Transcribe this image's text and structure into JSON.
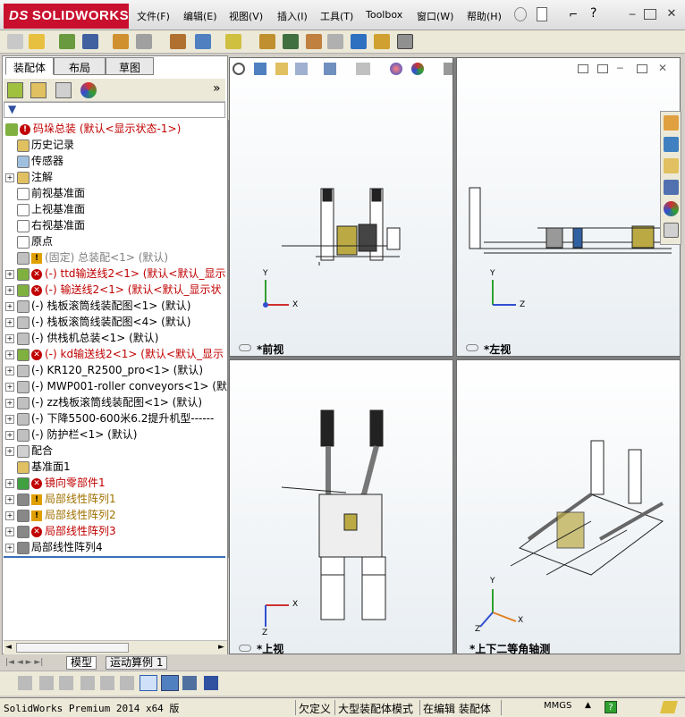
{
  "app": {
    "logo_prefix": "DS",
    "logo_name": "SOLIDWORKS"
  },
  "menu": {
    "items": [
      "文件(F)",
      "编辑(E)",
      "视图(V)",
      "插入(I)",
      "工具(T)",
      "Toolbox",
      "窗口(W)",
      "帮助(H)"
    ]
  },
  "left_tabs": [
    "装配体",
    "布局",
    "草图"
  ],
  "tree": {
    "root": "码垛总装   (默认<显示状态-1>)",
    "items": [
      {
        "label": "历史记录",
        "style": "normal",
        "expand": false,
        "status": ""
      },
      {
        "label": "传感器",
        "style": "normal",
        "expand": false,
        "status": ""
      },
      {
        "label": "注解",
        "style": "normal",
        "expand": true,
        "status": ""
      },
      {
        "label": "前视基准面",
        "style": "normal",
        "expand": false,
        "status": ""
      },
      {
        "label": "上视基准面",
        "style": "normal",
        "expand": false,
        "status": ""
      },
      {
        "label": "右视基准面",
        "style": "normal",
        "expand": false,
        "status": ""
      },
      {
        "label": "原点",
        "style": "normal",
        "expand": false,
        "status": ""
      },
      {
        "label": "(固定) 总装配<1> (默认)",
        "style": "gray",
        "expand": false,
        "status": "warn"
      },
      {
        "label": "(-) ttd输送线2<1> (默认<默认_显示",
        "style": "red",
        "expand": true,
        "status": "err"
      },
      {
        "label": "(-) 输送线2<1> (默认<默认_显示状",
        "style": "red",
        "expand": true,
        "status": "err"
      },
      {
        "label": "(-) 栈板滚筒线装配图<1> (默认)",
        "style": "normal",
        "expand": true,
        "status": ""
      },
      {
        "label": "(-) 栈板滚筒线装配图<4> (默认)",
        "style": "normal",
        "expand": true,
        "status": ""
      },
      {
        "label": "(-) 供栈机总装<1> (默认)",
        "style": "normal",
        "expand": true,
        "status": ""
      },
      {
        "label": "(-) kd输送线2<1> (默认<默认_显示",
        "style": "red",
        "expand": true,
        "status": "err"
      },
      {
        "label": "(-) KR120_R2500_pro<1> (默认)",
        "style": "normal",
        "expand": true,
        "status": ""
      },
      {
        "label": "(-) MWP001-roller conveyors<1> (默认",
        "style": "normal",
        "expand": true,
        "status": ""
      },
      {
        "label": "(-) zz栈板滚筒线装配图<1> (默认)",
        "style": "normal",
        "expand": true,
        "status": ""
      },
      {
        "label": "(-) 下降5500-600米6.2提升机型------",
        "style": "normal",
        "expand": true,
        "status": ""
      },
      {
        "label": "(-) 防护栏<1> (默认)",
        "style": "normal",
        "expand": true,
        "status": ""
      },
      {
        "label": "配合",
        "style": "normal",
        "expand": true,
        "status": ""
      },
      {
        "label": "基准面1",
        "style": "normal",
        "expand": false,
        "status": ""
      },
      {
        "label": "镜向零部件1",
        "style": "red",
        "expand": true,
        "status": "err"
      },
      {
        "label": "局部线性阵列1",
        "style": "warnc",
        "expand": true,
        "status": "warn"
      },
      {
        "label": "局部线性阵列2",
        "style": "warnc",
        "expand": true,
        "status": "warn"
      },
      {
        "label": "局部线性阵列3",
        "style": "red",
        "expand": true,
        "status": "err"
      },
      {
        "label": "局部线性阵列4",
        "style": "normal",
        "expand": true,
        "status": ""
      }
    ]
  },
  "viewports": {
    "front": "*前视",
    "left": "*左视",
    "top": "*上视",
    "iso": "*上下二等角轴测"
  },
  "axes": {
    "x": "X",
    "y": "Y",
    "z": "Z"
  },
  "bottom_tabs": [
    "模型",
    "运动算例 1"
  ],
  "status": {
    "product": "SolidWorks Premium 2014 x64 版",
    "state": "欠定义",
    "mode": "大型装配体模式",
    "editing": "在编辑 装配体",
    "units": "MMGS"
  },
  "colors": {
    "error": "#c00000",
    "warning": "#e0a000",
    "accent": "#3b6fb6"
  }
}
